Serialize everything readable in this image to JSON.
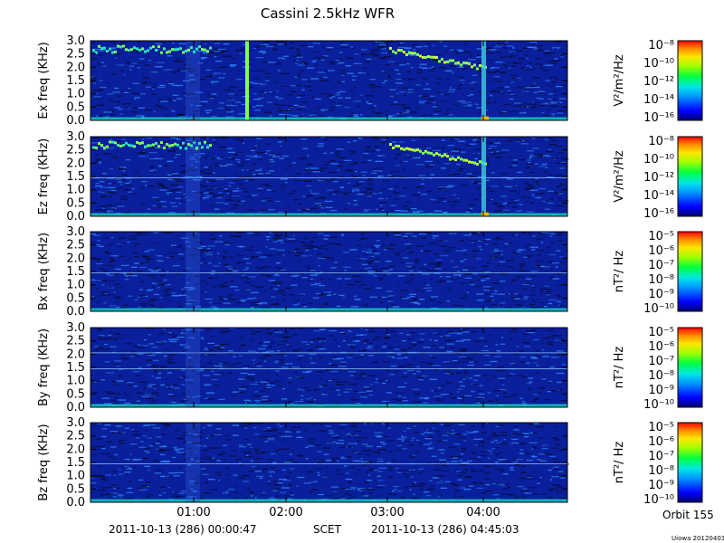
{
  "title": "Cassini 2.5kHz WFR",
  "footer": {
    "start_label": "2011-10-13 (286) 00:00:47",
    "axis_label": "SCET",
    "end_label": "2011-10-13 (286) 04:45:03",
    "orbit_label": "Orbit 155",
    "credit": "Uiowa 20120403"
  },
  "colors": {
    "background_field": "#0a1f9c",
    "noise_dark": "#050a2a",
    "noise_light": "#2e8cff",
    "low_band": "#18e0c8",
    "bright_line": "#7dff5a"
  },
  "chart_data": [
    {
      "type": "heatmap",
      "ylabel": "Ex freq (KHz)",
      "y_ticks": [
        "3.0",
        "2.5",
        "2.0",
        "1.5",
        "1.0",
        "0.5",
        "0.0"
      ],
      "ylim": [
        0,
        3.0
      ],
      "x_ticks": [
        "01:00",
        "02:00",
        "03:00",
        "04:00"
      ],
      "colorbar_label": "V²/m²/Hz",
      "colorbar_ticks": [
        "10⁻⁸",
        "10⁻¹⁰",
        "10⁻¹²",
        "10⁻¹⁴",
        "10⁻¹⁶"
      ]
    },
    {
      "type": "heatmap",
      "ylabel": "Ez freq (KHz)",
      "y_ticks": [
        "3.0",
        "2.5",
        "2.0",
        "1.5",
        "1.0",
        "0.5",
        "0.0"
      ],
      "ylim": [
        0,
        3.0
      ],
      "x_ticks": [
        "01:00",
        "02:00",
        "03:00",
        "04:00"
      ],
      "colorbar_label": "V²/m²/Hz",
      "colorbar_ticks": [
        "10⁻⁸",
        "10⁻¹⁰",
        "10⁻¹²",
        "10⁻¹⁴",
        "10⁻¹⁶"
      ]
    },
    {
      "type": "heatmap",
      "ylabel": "Bx freq (KHz)",
      "y_ticks": [
        "3.0",
        "2.5",
        "2.0",
        "1.5",
        "1.0",
        "0.5",
        "0.0"
      ],
      "ylim": [
        0,
        3.0
      ],
      "x_ticks": [
        "01:00",
        "02:00",
        "03:00",
        "04:00"
      ],
      "colorbar_label": "nT²/ Hz",
      "colorbar_ticks": [
        "10⁻⁵",
        "10⁻⁶",
        "10⁻⁷",
        "10⁻⁸",
        "10⁻⁹",
        "10⁻¹⁰"
      ]
    },
    {
      "type": "heatmap",
      "ylabel": "By freq (KHz)",
      "y_ticks": [
        "3.0",
        "2.5",
        "2.0",
        "1.5",
        "1.0",
        "0.5",
        "0.0"
      ],
      "ylim": [
        0,
        3.0
      ],
      "x_ticks": [
        "01:00",
        "02:00",
        "03:00",
        "04:00"
      ],
      "colorbar_label": "nT²/ Hz",
      "colorbar_ticks": [
        "10⁻⁵",
        "10⁻⁶",
        "10⁻⁷",
        "10⁻⁸",
        "10⁻⁹",
        "10⁻¹⁰"
      ]
    },
    {
      "type": "heatmap",
      "ylabel": "Bz freq (KHz)",
      "y_ticks": [
        "3.0",
        "2.5",
        "2.0",
        "1.5",
        "1.0",
        "0.5",
        "0.0"
      ],
      "ylim": [
        0,
        3.0
      ],
      "x_ticks": [
        "01:00",
        "02:00",
        "03:00",
        "04:00"
      ],
      "colorbar_label": "nT²/ Hz",
      "colorbar_ticks": [
        "10⁻⁵",
        "10⁻⁶",
        "10⁻⁷",
        "10⁻⁸",
        "10⁻⁹",
        "10⁻¹⁰"
      ]
    }
  ]
}
